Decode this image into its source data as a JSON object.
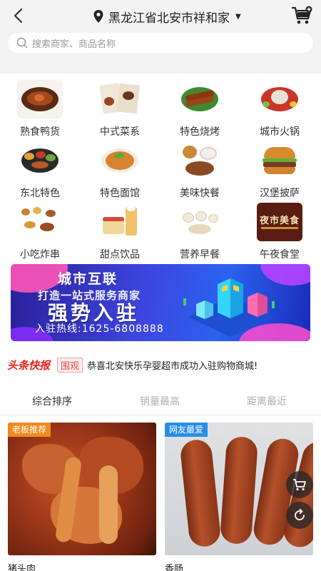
{
  "header": {
    "location": "黑龙江省北安市祥和家",
    "search_placeholder": "搜索商家、商品名称"
  },
  "categories": [
    {
      "label": "熟食鸭货",
      "icon": "duck-dish-icon"
    },
    {
      "label": "中式菜系",
      "icon": "chinese-menu-icon"
    },
    {
      "label": "特色烧烤",
      "icon": "bbq-skewers-icon"
    },
    {
      "label": "城市火锅",
      "icon": "hotpot-icon"
    },
    {
      "label": "东北特色",
      "icon": "northeast-platter-icon"
    },
    {
      "label": "特色面馆",
      "icon": "noodle-bowl-icon"
    },
    {
      "label": "美味快餐",
      "icon": "fast-meal-icon"
    },
    {
      "label": "汉堡披萨",
      "icon": "burger-icon"
    },
    {
      "label": "小吃炸串",
      "icon": "snack-skewers-icon"
    },
    {
      "label": "甜点饮品",
      "icon": "dessert-drink-icon"
    },
    {
      "label": "营养早餐",
      "icon": "breakfast-icon"
    },
    {
      "label": "午夜食堂",
      "icon": "midnight-canteen-icon"
    }
  ],
  "banner": {
    "title": "城市互联",
    "subtitle": "打造一站式服务商家",
    "headline": "强势入驻",
    "hotline": "入驻热线:1625-6808888"
  },
  "news": {
    "logo": "头条快报",
    "tag": "围观",
    "text": "恭喜北安快乐孕婴超市成功入驻购物商城!"
  },
  "sort_tabs": [
    {
      "label": "综合排序",
      "active": true
    },
    {
      "label": "销量最高",
      "active": false
    },
    {
      "label": "距离最近",
      "active": false
    }
  ],
  "products": [
    {
      "name": "猪头肉",
      "badge": "老板推荐",
      "badge_color": "#f08a1f"
    },
    {
      "name": "香肠",
      "badge": "网友最爱",
      "badge_color": "#2a8ee8"
    }
  ],
  "midnight_thumb_text": "夜市美食"
}
